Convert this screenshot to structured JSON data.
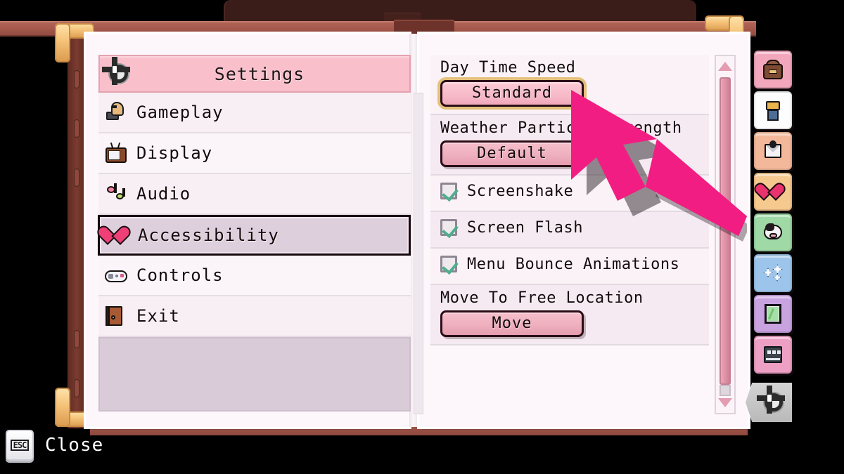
{
  "window": {
    "title": "Settings",
    "gear_icon": "gear-icon"
  },
  "menu": {
    "header_label": "Settings",
    "items": [
      {
        "label": "Gameplay",
        "icon": "chess-knight-icon",
        "selected": false
      },
      {
        "label": "Display",
        "icon": "television-icon",
        "selected": false
      },
      {
        "label": "Audio",
        "icon": "music-note-icon",
        "selected": false
      },
      {
        "label": "Accessibility",
        "icon": "heart-icon",
        "selected": true
      },
      {
        "label": "Controls",
        "icon": "gamepad-icon",
        "selected": false
      },
      {
        "label": "Exit",
        "icon": "door-icon",
        "selected": false
      }
    ]
  },
  "settings_panel": {
    "rows": [
      {
        "type": "option",
        "label": "Day Time Speed",
        "value": "Standard",
        "selected": true
      },
      {
        "type": "option",
        "label": "Weather Particle Strength",
        "value": "Default",
        "selected": false
      },
      {
        "type": "checkbox",
        "label": "Screenshake",
        "checked": true
      },
      {
        "type": "checkbox",
        "label": "Screen Flash",
        "checked": true
      },
      {
        "type": "checkbox",
        "label": "Menu Bounce Animations",
        "checked": true
      },
      {
        "type": "option",
        "label": "Move To Free Location",
        "value": "Move",
        "selected": false
      }
    ]
  },
  "scrollbar": {
    "up_arrow": "scroll-up-arrow-icon",
    "down_arrow": "scroll-down-arrow-icon"
  },
  "tabs": [
    {
      "name": "inventory",
      "icon": "backpack-icon",
      "color": "#f2a7bd"
    },
    {
      "name": "wardrobe",
      "icon": "shirt-icon",
      "color": "#fdfdfd"
    },
    {
      "name": "mail",
      "icon": "letter-icon",
      "color": "#f3b89a"
    },
    {
      "name": "relationships",
      "icon": "heart-icon",
      "color": "#f6c98e"
    },
    {
      "name": "animals",
      "icon": "cow-icon",
      "color": "#9fd9a6"
    },
    {
      "name": "skills",
      "icon": "sparkle-icon",
      "color": "#9dc4ea"
    },
    {
      "name": "map",
      "icon": "map-icon",
      "color": "#c9a2e0"
    },
    {
      "name": "journal",
      "icon": "journal-icon",
      "color": "#eda0c4"
    }
  ],
  "settings_tab": {
    "name": "settings",
    "icon": "gear-icon",
    "active": true
  },
  "footer": {
    "key_label": "ESC",
    "action_label": "Close"
  },
  "cursor": {
    "icon": "arrow-cursor",
    "color": "#f21d82"
  },
  "colors": {
    "accent_pink": "#f9c0cc",
    "page_bg": "#fdf7fb",
    "selected_border": "#e3c07a",
    "check_green": "#4fae8e",
    "cursor_pink": "#f21d82",
    "book_brown": "#3a1d19",
    "gold": "#f5c278"
  }
}
